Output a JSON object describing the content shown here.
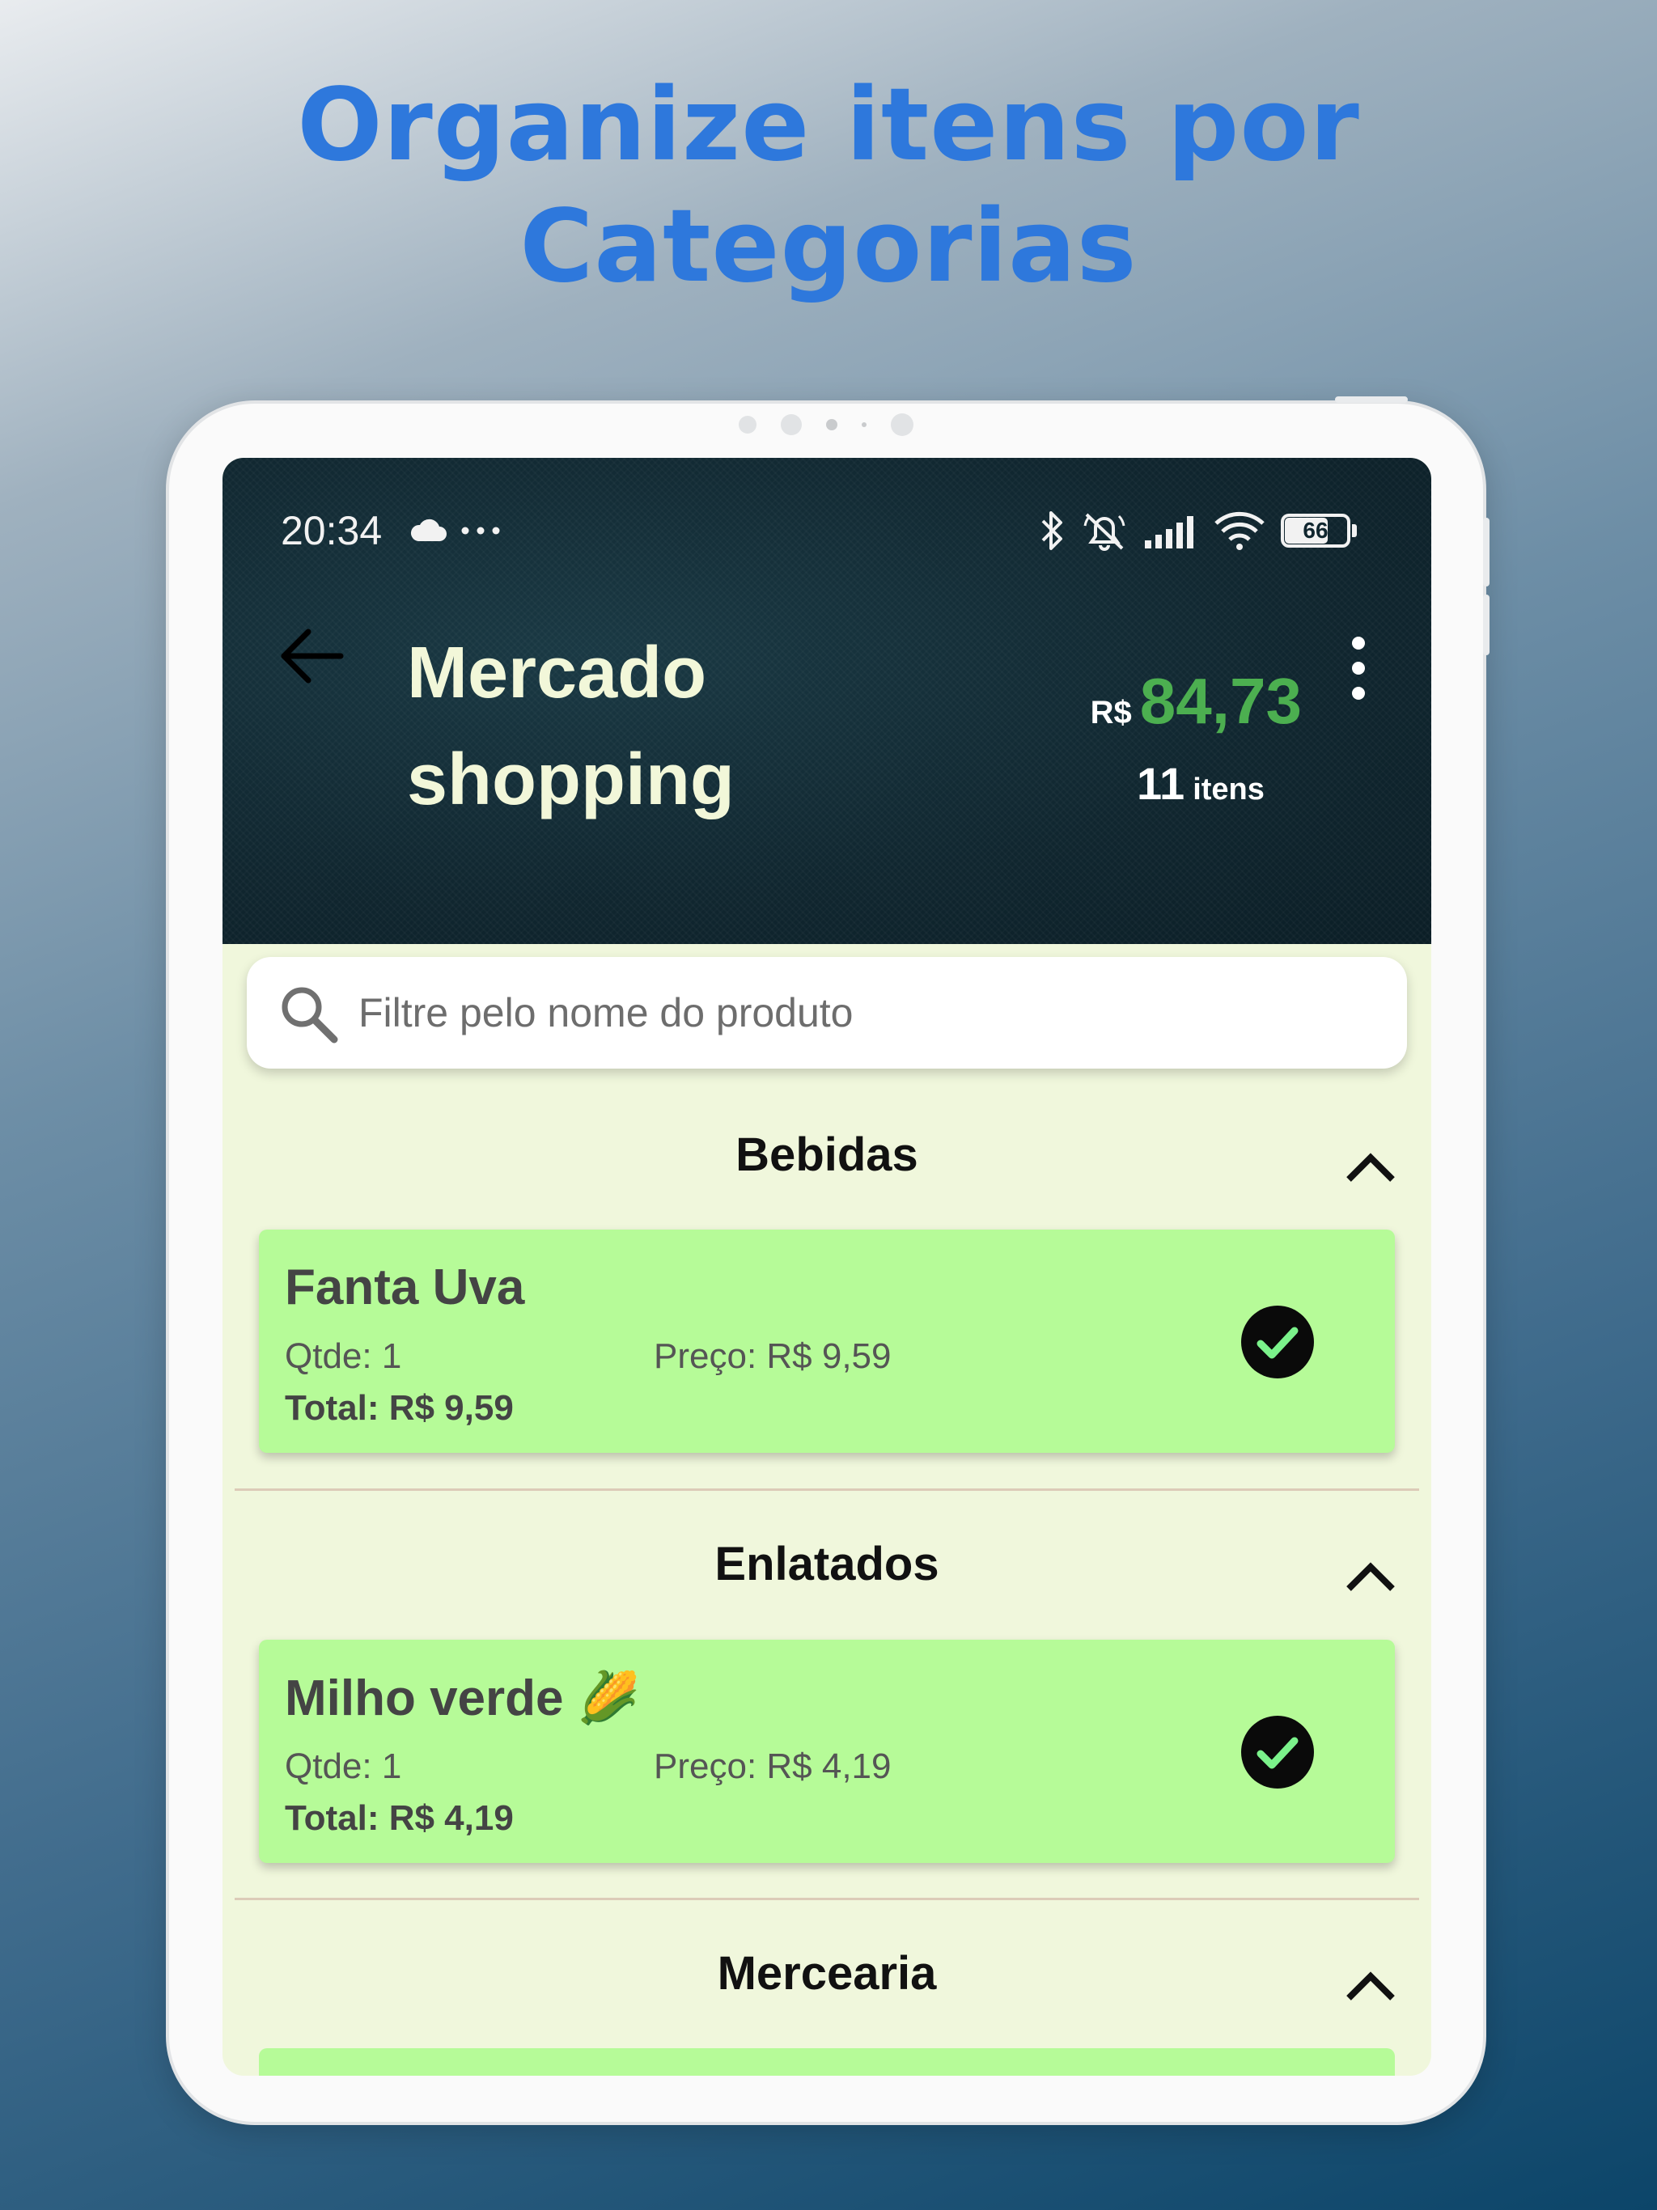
{
  "promo": {
    "headline_line1": "Organize itens por",
    "headline_line2": "Categorias"
  },
  "status_bar": {
    "time": "20:34",
    "battery": "66",
    "icons": [
      "cloud-icon",
      "more-dots-icon",
      "bluetooth-icon",
      "muted-bell-icon",
      "signal-icon",
      "wifi-icon",
      "battery-icon"
    ]
  },
  "header": {
    "title_line1": "Mercado",
    "title_line2": "shopping",
    "currency": "R$",
    "total": "84,73",
    "item_count": "11",
    "item_count_label": "itens"
  },
  "search": {
    "placeholder": "Filtre pelo nome do produto"
  },
  "categories": [
    {
      "name": "Bebidas",
      "items": [
        {
          "name": "Fanta Uva",
          "qty": "Qtde: 1",
          "price": "Preço: R$ 9,59",
          "total": "Total: R$ 9,59",
          "checked": true
        }
      ]
    },
    {
      "name": "Enlatados",
      "items": [
        {
          "name": "Milho verde 🌽",
          "qty": "Qtde: 1",
          "price": "Preço: R$ 4,19",
          "total": "Total: R$ 4,19",
          "checked": true
        }
      ]
    },
    {
      "name": "Mercearia",
      "items": []
    }
  ],
  "colors": {
    "headline": "#2e78dc",
    "accent_green": "#4caf50",
    "card_bg": "#b6fb98",
    "screen_bg": "#f0f7dc",
    "header_bg": "#10262f"
  }
}
